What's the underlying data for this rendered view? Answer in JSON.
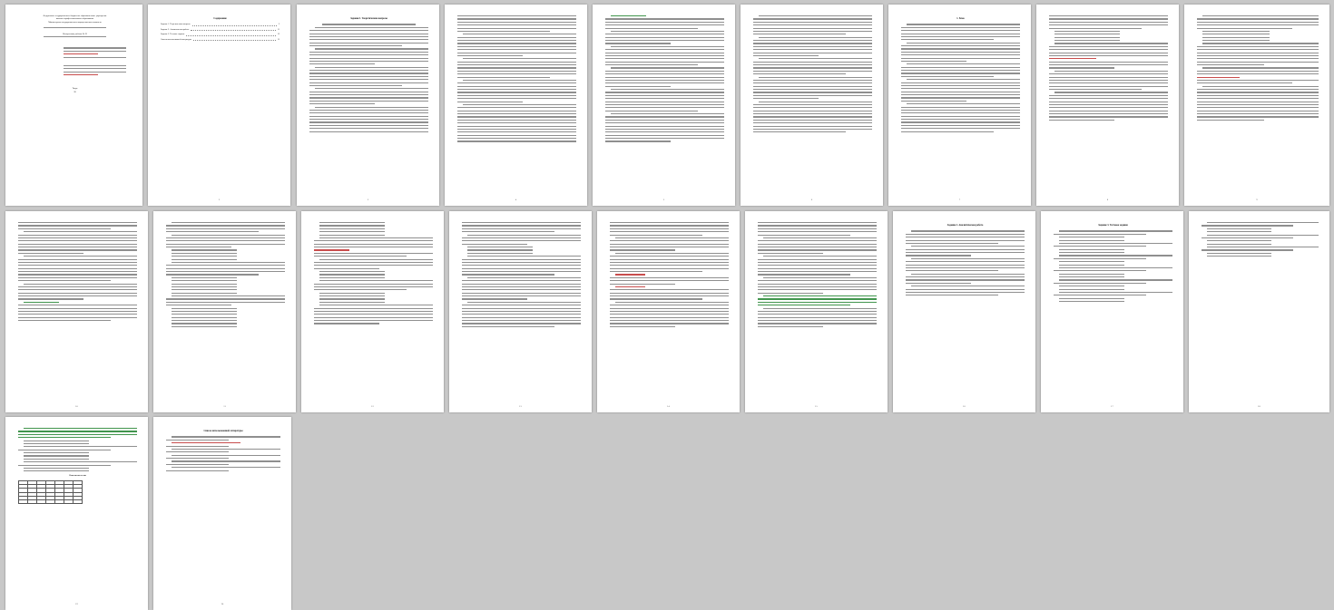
{
  "document": {
    "cover": {
      "lines": [
        "Федеральное государственное бюджетное образовательное учреждение",
        "высшего профессионального образования",
        "Министерство государственного имущественного комитета",
        "Контрольная работа № 19"
      ],
      "city": "Тверь",
      "year": "20"
    },
    "toc": {
      "heading": "Содержание",
      "items": [
        {
          "label": "Задание 1. Теоретические вопросы",
          "page": "3"
        },
        {
          "label": "Задание 2. Аналитическая работа",
          "page": "11"
        },
        {
          "label": "Задание 3. Тестовое задание",
          "page": "13"
        },
        {
          "label": "Список использованной литературы",
          "page": "15"
        }
      ]
    },
    "headings": {
      "p3": "Задание 1. Теоретические вопросы",
      "p9": "1. Блок",
      "p16": "Задание 2. Аналитическая работа",
      "p17": "Задание 3. Тестовое задание",
      "p19": "Список использованной литературы",
      "answers": "Ответы на тесты"
    },
    "page_numbers": [
      "2",
      "3",
      "4",
      "5",
      "6",
      "7",
      "8",
      "9",
      "10",
      "11",
      "12",
      "13",
      "14",
      "15",
      "16",
      "17",
      "18",
      "19",
      "20"
    ]
  }
}
